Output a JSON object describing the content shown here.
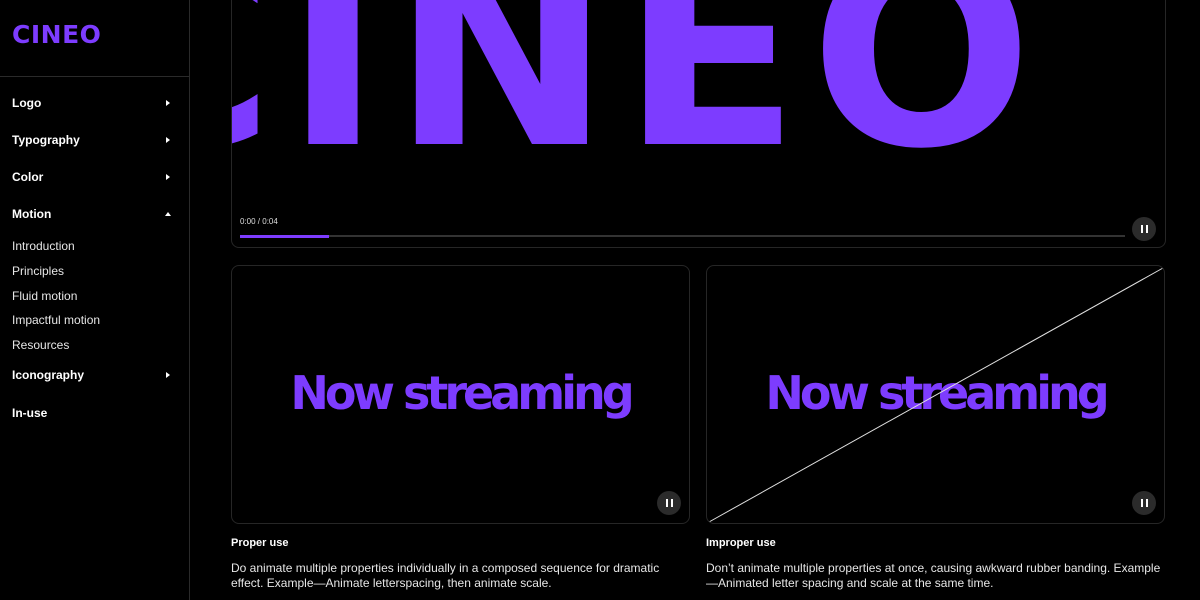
{
  "brand": {
    "logo": "CINEO",
    "accent": "#7d3cff"
  },
  "sidebar": {
    "items": [
      {
        "label": "Logo",
        "state": "collapsed"
      },
      {
        "label": "Typography",
        "state": "collapsed"
      },
      {
        "label": "Color",
        "state": "collapsed"
      },
      {
        "label": "Motion",
        "state": "expanded"
      },
      {
        "label": "Iconography",
        "state": "collapsed"
      },
      {
        "label": "In-use"
      }
    ],
    "motion_subitems": [
      "Introduction",
      "Principles",
      "Fluid motion",
      "Impactful motion",
      "Resources"
    ]
  },
  "hero_video": {
    "display_text": "CINEO",
    "time": "0:00 / 0:04",
    "progress": 0.1,
    "control": "pause"
  },
  "examples": [
    {
      "video_text": "Now streaming",
      "title": "Proper use",
      "description": "Do animate multiple properties individually in a composed sequence for dramatic effect. Example—Animate letterspacing, then animate scale.",
      "control": "pause"
    },
    {
      "video_text": "Now streaming",
      "title": "Improper use",
      "description": "Don’t animate multiple properties at once, causing awkward rubber banding. Example—Animated letter spacing and scale at the same time.",
      "control": "pause"
    }
  ]
}
